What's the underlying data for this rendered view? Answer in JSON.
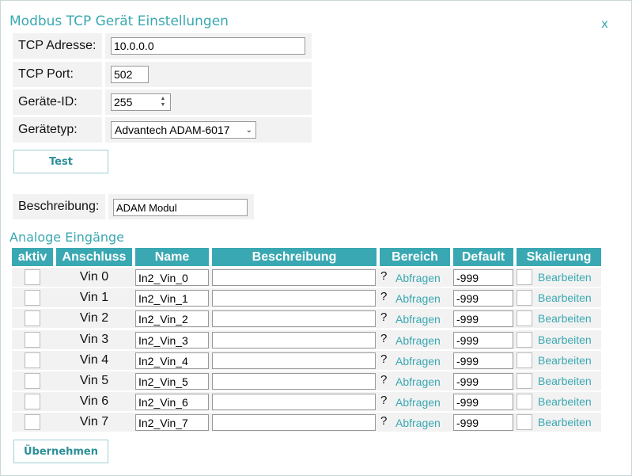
{
  "dialog": {
    "title": "Modbus TCP Gerät Einstellungen",
    "close_label": "x"
  },
  "settings": {
    "tcp_address": {
      "label": "TCP Adresse:",
      "value": "10.0.0.0"
    },
    "tcp_port": {
      "label": "TCP Port:",
      "value": "502"
    },
    "device_id": {
      "label": "Geräte-ID:",
      "value": "255"
    },
    "device_type": {
      "label": "Gerätetyp:",
      "value": "Advantech ADAM-6017"
    },
    "test_button": "Test",
    "description": {
      "label": "Beschreibung:",
      "value": "ADAM Modul"
    }
  },
  "analog": {
    "section_title": "Analoge Eingänge",
    "columns": [
      "aktiv",
      "Anschluss",
      "Name",
      "Beschreibung",
      "Bereich",
      "Default",
      "Skalierung"
    ],
    "range_hint": "?",
    "range_link": "Abfragen",
    "scale_link": "Bearbeiten",
    "rows": [
      {
        "active": false,
        "port": "Vin 0",
        "name": "In2_Vin_0",
        "description": "",
        "default": "-999"
      },
      {
        "active": false,
        "port": "Vin 1",
        "name": "In2_Vin_1",
        "description": "",
        "default": "-999"
      },
      {
        "active": false,
        "port": "Vin 2",
        "name": "In2_Vin_2",
        "description": "",
        "default": "-999"
      },
      {
        "active": false,
        "port": "Vin 3",
        "name": "In2_Vin_3",
        "description": "",
        "default": "-999"
      },
      {
        "active": false,
        "port": "Vin 4",
        "name": "In2_Vin_4",
        "description": "",
        "default": "-999"
      },
      {
        "active": false,
        "port": "Vin 5",
        "name": "In2_Vin_5",
        "description": "",
        "default": "-999"
      },
      {
        "active": false,
        "port": "Vin 6",
        "name": "In2_Vin_6",
        "description": "",
        "default": "-999"
      },
      {
        "active": false,
        "port": "Vin 7",
        "name": "In2_Vin_7",
        "description": "",
        "default": "-999"
      }
    ]
  },
  "apply_button": "Übernehmen",
  "colors": {
    "accent": "#3aa8b2",
    "row_bg": "#f2f2f2"
  }
}
